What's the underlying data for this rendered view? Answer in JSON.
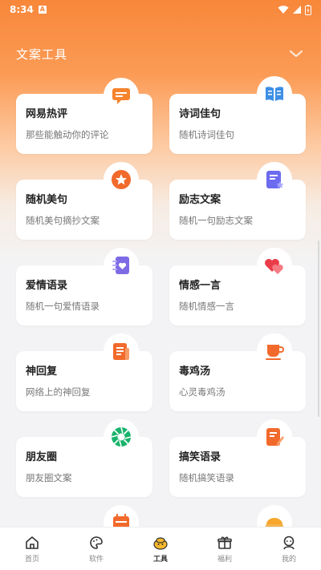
{
  "status_bar": {
    "time": "8:34",
    "badge": "A"
  },
  "header": {
    "title": "文案工具"
  },
  "cards": [
    {
      "name": "网易热评",
      "desc": "那些能触动你的评论",
      "icon": "message-icon",
      "color": "#f7832d"
    },
    {
      "name": "诗词佳句",
      "desc": "随机诗词佳句",
      "icon": "book-icon",
      "color": "#3d8fe6"
    },
    {
      "name": "随机美句",
      "desc": "随机美句摘抄文案",
      "icon": "star-icon",
      "color": "#f26a2b"
    },
    {
      "name": "励志文案",
      "desc": "随机一句励志文案",
      "icon": "list-star-icon",
      "color": "#6c6bf0"
    },
    {
      "name": "爱情语录",
      "desc": "随机一句爱情语录",
      "icon": "heart-card-icon",
      "color": "#7d6be6"
    },
    {
      "name": "情感一言",
      "desc": "随机情感一言",
      "icon": "hearts-icon",
      "color": "#ea3d4a"
    },
    {
      "name": "神回复",
      "desc": "网络上的神回复",
      "icon": "document-icon",
      "color": "#f26a2b"
    },
    {
      "name": "毒鸡汤",
      "desc": "心灵毒鸡汤",
      "icon": "cup-icon",
      "color": "#f26a2b"
    },
    {
      "name": "朋友圈",
      "desc": "朋友圈文案",
      "icon": "aperture-icon",
      "color": "#19b36b"
    },
    {
      "name": "搞笑语录",
      "desc": "随机搞笑语录",
      "icon": "edit-note-icon",
      "color": "#f26a2b"
    }
  ],
  "tabs": [
    {
      "label": "首页",
      "icon": "home-icon"
    },
    {
      "label": "软件",
      "icon": "palette-icon"
    },
    {
      "label": "工具",
      "icon": "tools-mascot-icon",
      "active": true
    },
    {
      "label": "福利",
      "icon": "gift-icon"
    },
    {
      "label": "我的",
      "icon": "profile-icon"
    }
  ]
}
